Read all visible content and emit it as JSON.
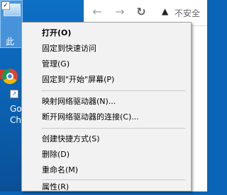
{
  "desktop": {
    "icon1_label": "此",
    "icon1_checkbox": "✓",
    "icon2_label_line1": "Go",
    "icon2_label_line2": "Ch"
  },
  "browser": {
    "back_icon": "arrow-left-icon",
    "forward_icon": "arrow-right-icon",
    "reload_icon": "reload-icon",
    "security_icon": "warning-icon",
    "security_text": "不安全"
  },
  "context_menu": {
    "items": [
      {
        "label": "打开(O)",
        "bold": true
      },
      {
        "label": "固定到快速访问"
      },
      {
        "label": "管理(G)"
      },
      {
        "label": "固定到\"开始\"屏幕(P)"
      },
      {
        "label": "映射网络驱动器(N)..."
      },
      {
        "label": "断开网络驱动器的连接(C)..."
      },
      {
        "label": "创建快捷方式(S)"
      },
      {
        "label": "删除(D)"
      },
      {
        "label": "重命名(M)"
      },
      {
        "label": "属性(R)"
      }
    ]
  }
}
